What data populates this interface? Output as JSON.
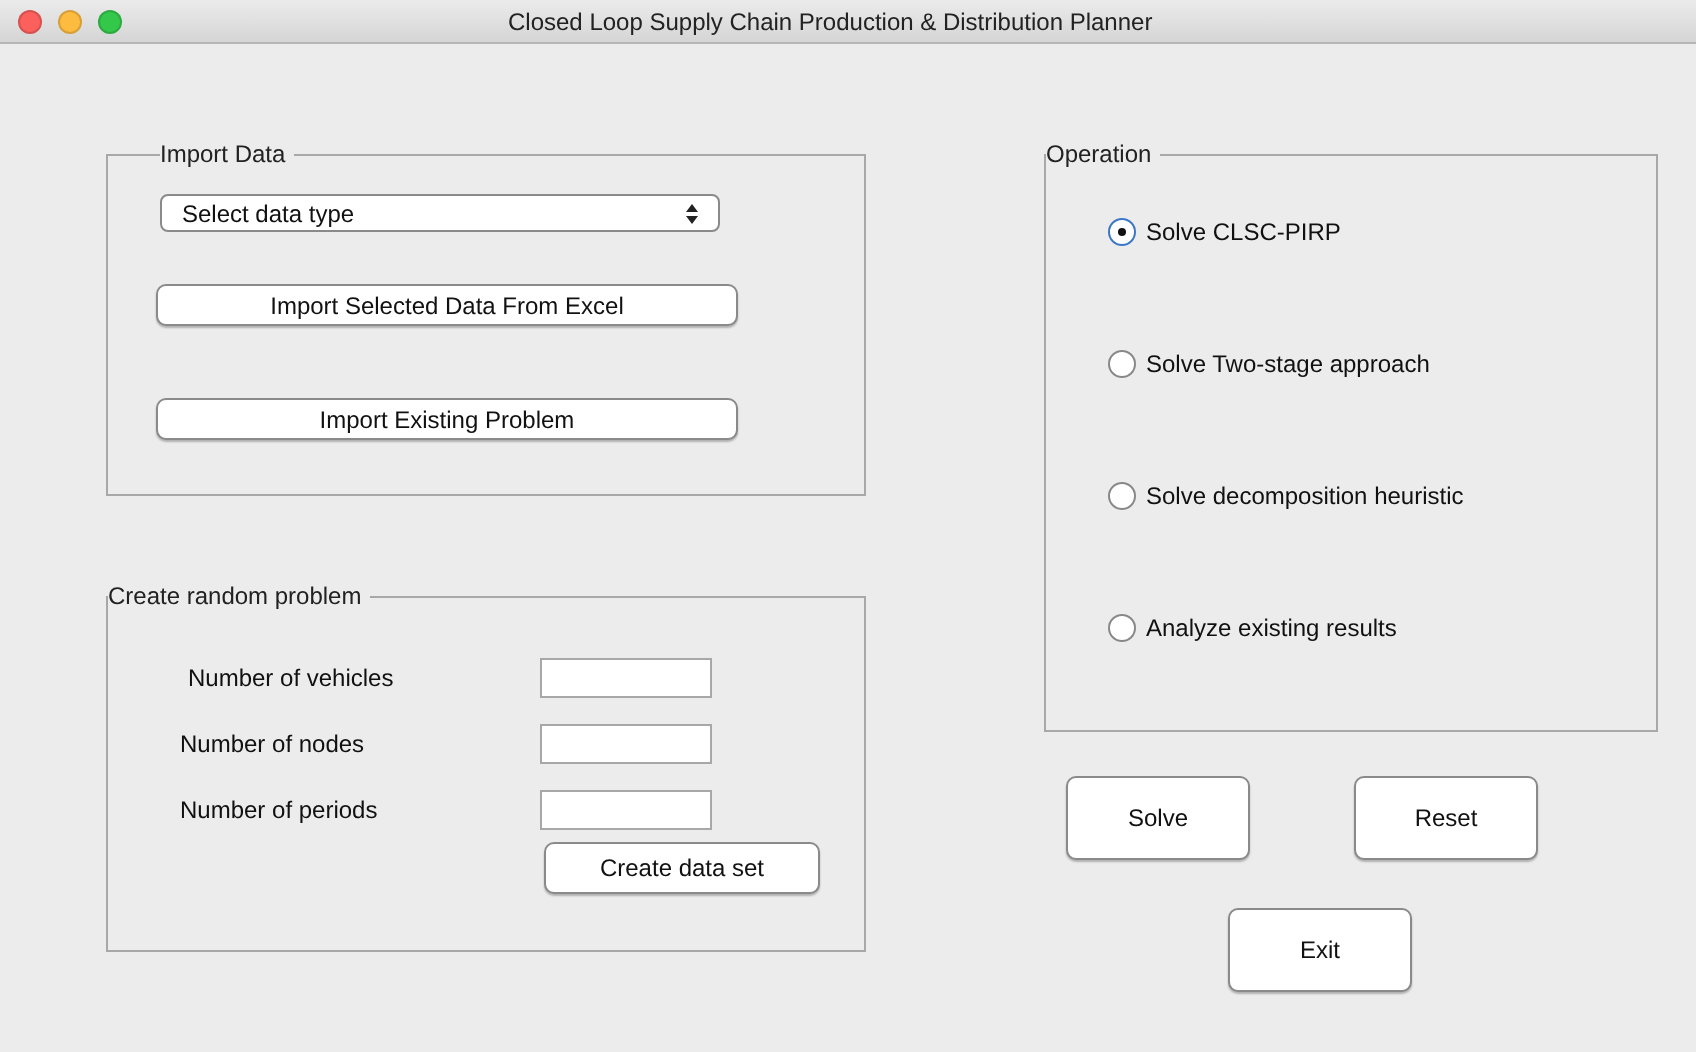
{
  "window": {
    "title": "Closed Loop Supply Chain Production & Distribution Planner"
  },
  "import_data": {
    "title": "Import Data",
    "select": {
      "value": "Select data type"
    },
    "buttons": [
      "Import Selected Data From Excel",
      "Import Existing Problem"
    ]
  },
  "random_problem": {
    "title": "Create random problem",
    "fields": [
      {
        "label": "Number of vehicles"
      },
      {
        "label": "Number of nodes"
      },
      {
        "label": "Number of periods"
      }
    ],
    "button": "Create data set"
  },
  "operation": {
    "title": "Operation",
    "options": [
      {
        "label": "Solve CLSC-PIRP",
        "selected": true
      },
      {
        "label": "Solve Two-stage approach",
        "selected": false
      },
      {
        "label": "Solve decomposition heuristic",
        "selected": false
      },
      {
        "label": "Analyze existing results",
        "selected": false
      }
    ]
  },
  "actions": [
    "Solve",
    "Reset"
  ],
  "exit": "Exit"
}
